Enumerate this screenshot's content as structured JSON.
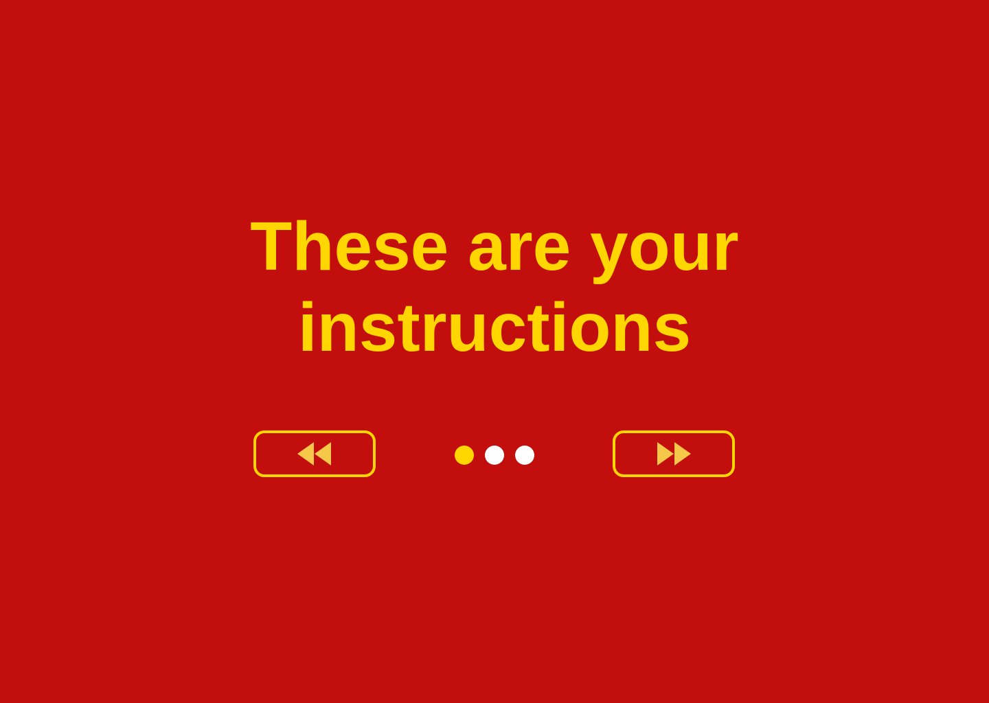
{
  "title": {
    "line1": "These are your",
    "line2": "instructions"
  },
  "nav": {
    "prev_icon": "rewind-icon",
    "next_icon": "fast-forward-icon"
  },
  "pagination": {
    "total": 3,
    "current": 1
  },
  "colors": {
    "background": "#C20E0C",
    "accent": "#FFD600",
    "icon_fill": "#F5C84A",
    "inactive_dot": "#FFFFFF"
  }
}
